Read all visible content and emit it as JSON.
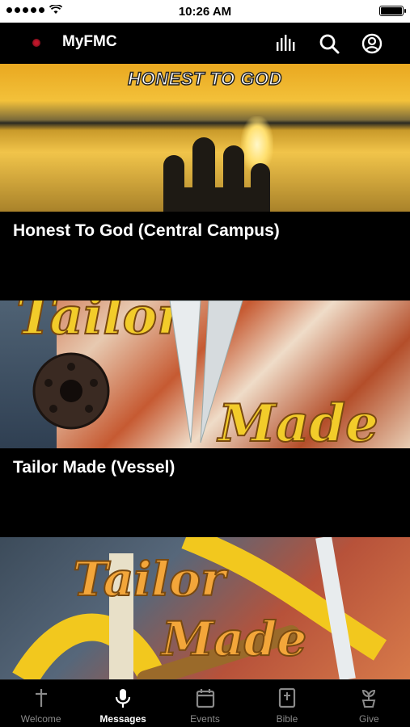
{
  "status_bar": {
    "time": "10:26 AM"
  },
  "header": {
    "title": "MyFMC"
  },
  "messages": [
    {
      "title": "Honest To God (Central Campus)",
      "image_text": "HONEST TO GOD"
    },
    {
      "title": "Tailor Made (Vessel)",
      "image_text_1": "Tailor",
      "image_text_2": "Made"
    },
    {
      "image_text_1": "Tailor",
      "image_text_2": "Made"
    }
  ],
  "tabs": [
    {
      "label": "Welcome",
      "icon": "cross-icon"
    },
    {
      "label": "Messages",
      "icon": "microphone-icon",
      "active": true
    },
    {
      "label": "Events",
      "icon": "calendar-icon"
    },
    {
      "label": "Bible",
      "icon": "bible-icon"
    },
    {
      "label": "Give",
      "icon": "plant-icon"
    }
  ],
  "colors": {
    "background": "#000000",
    "active_tab": "#ffffff",
    "inactive_tab": "#8a8a8a",
    "logo": "#c0162a"
  }
}
